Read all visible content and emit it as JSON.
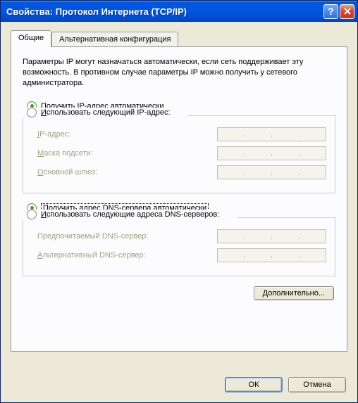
{
  "window": {
    "title": "Свойства: Протокол Интернета (TCP/IP)"
  },
  "tabs": {
    "general": "Общие",
    "alternate": "Альтернативная конфигурация"
  },
  "description": "Параметры IP могут назначаться автоматически, если сеть поддерживает эту возможность. В противном случае параметры IP можно получить у сетевого администратора.",
  "radios": {
    "auto_ip": "олучить IP-адрес автоматически",
    "auto_ip_u": "П",
    "manual_ip": "спользовать следующий IP-адрес:",
    "manual_ip_u": "И",
    "auto_dns": "олучить адрес DNS-сервера автоматически",
    "auto_dns_u": "П",
    "manual_dns": "спользовать следующие адреса DNS-серверов:",
    "manual_dns_u": "И"
  },
  "fields": {
    "ip_address": "P-адрес:",
    "ip_address_u": "I",
    "subnet": "аска подсети:",
    "subnet_u": "М",
    "gateway": "сновной шлюз:",
    "gateway_u": "О",
    "pref_dns": "Предпочитаемый DNS-сервер:",
    "alt_dns": "льтернативный DNS-сервер:",
    "alt_dns_u": "А"
  },
  "buttons": {
    "advanced": "ополнительно...",
    "advanced_u": "Д",
    "ok": "ОК",
    "cancel": "Отмена"
  },
  "state": {
    "ip_mode": "auto",
    "dns_mode": "auto"
  }
}
